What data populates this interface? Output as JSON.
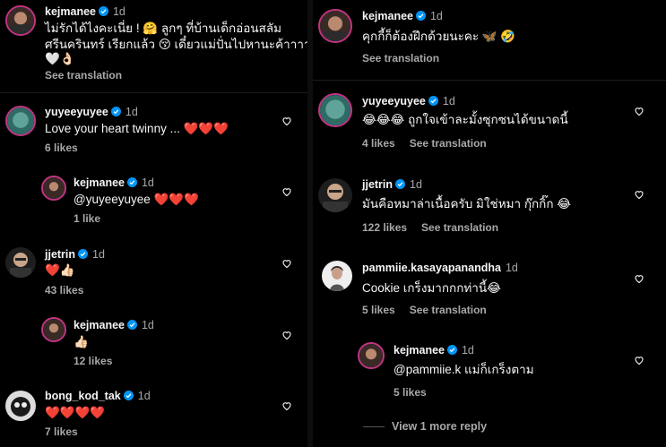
{
  "left": {
    "c0": {
      "user": "kejmanee",
      "time": "1d",
      "line1": "ไม่รักได้ไงคะเนี่ย ! 🤗  ลูกๆ ที่บ้านเด็กอ่อนสลัม",
      "line2": "ศรีนครินทร์ เรียกแล้ว 😚  เดี๋ยวแม่ปั่นไปหานะค้าาาา",
      "line3": "🤍👌🏻",
      "see_translation": "See translation"
    },
    "c1": {
      "user": "yuyeeyuyee",
      "time": "1d",
      "text": "Love your heart twinny ... ❤️❤️❤️",
      "likes": "6 likes"
    },
    "c2": {
      "user": "kejmanee",
      "time": "1d",
      "text": "@yuyeeyuyee ❤️❤️❤️",
      "likes": "1 like"
    },
    "c3": {
      "user": "jjetrin",
      "time": "1d",
      "text": "❤️👍🏻",
      "likes": "43 likes"
    },
    "c4": {
      "user": "kejmanee",
      "time": "1d",
      "text": "👍🏻",
      "likes": "12 likes"
    },
    "c5": {
      "user": "bong_kod_tak",
      "time": "1d",
      "text": "❤️❤️❤️❤️",
      "likes": "7 likes"
    }
  },
  "right": {
    "r0": {
      "user": "kejmanee",
      "time": "1d",
      "text": "คุกกี้ก็ต้องฝึกด้วยนะคะ 🦋 🤣",
      "see_translation": "See translation"
    },
    "r1": {
      "user": "yuyeeyuyee",
      "time": "1d",
      "text": "😂😂😂  ถูกใจเข้าละมั้งซุกซนได้ขนาดนี้",
      "likes": "4 likes",
      "see_translation": "See translation"
    },
    "r2": {
      "user": "jjetrin",
      "time": "1d",
      "text": "มันคือหมาล่าเนื้อครับ มิใช่หมา กุ๊กกิ๊ก 😂",
      "likes": "122 likes",
      "see_translation": "See translation"
    },
    "r3": {
      "user": "pammiie.kasayapanandha",
      "time": "1d",
      "text": "Cookie เกร็งมากกกท่านี้😂",
      "likes": "5 likes",
      "see_translation": "See translation"
    },
    "r4": {
      "user": "kejmanee",
      "time": "1d",
      "text": "@pammiie.k แม่ก็เกร็งตาม",
      "likes": "5 likes"
    },
    "view_more": "View 1 more reply"
  },
  "icons": {
    "verified": "verified-badge-icon",
    "like": "heart-outline-icon"
  },
  "colors": {
    "verified": "#0095f6",
    "background": "#000000",
    "secondary_text": "#a8a8a8"
  }
}
